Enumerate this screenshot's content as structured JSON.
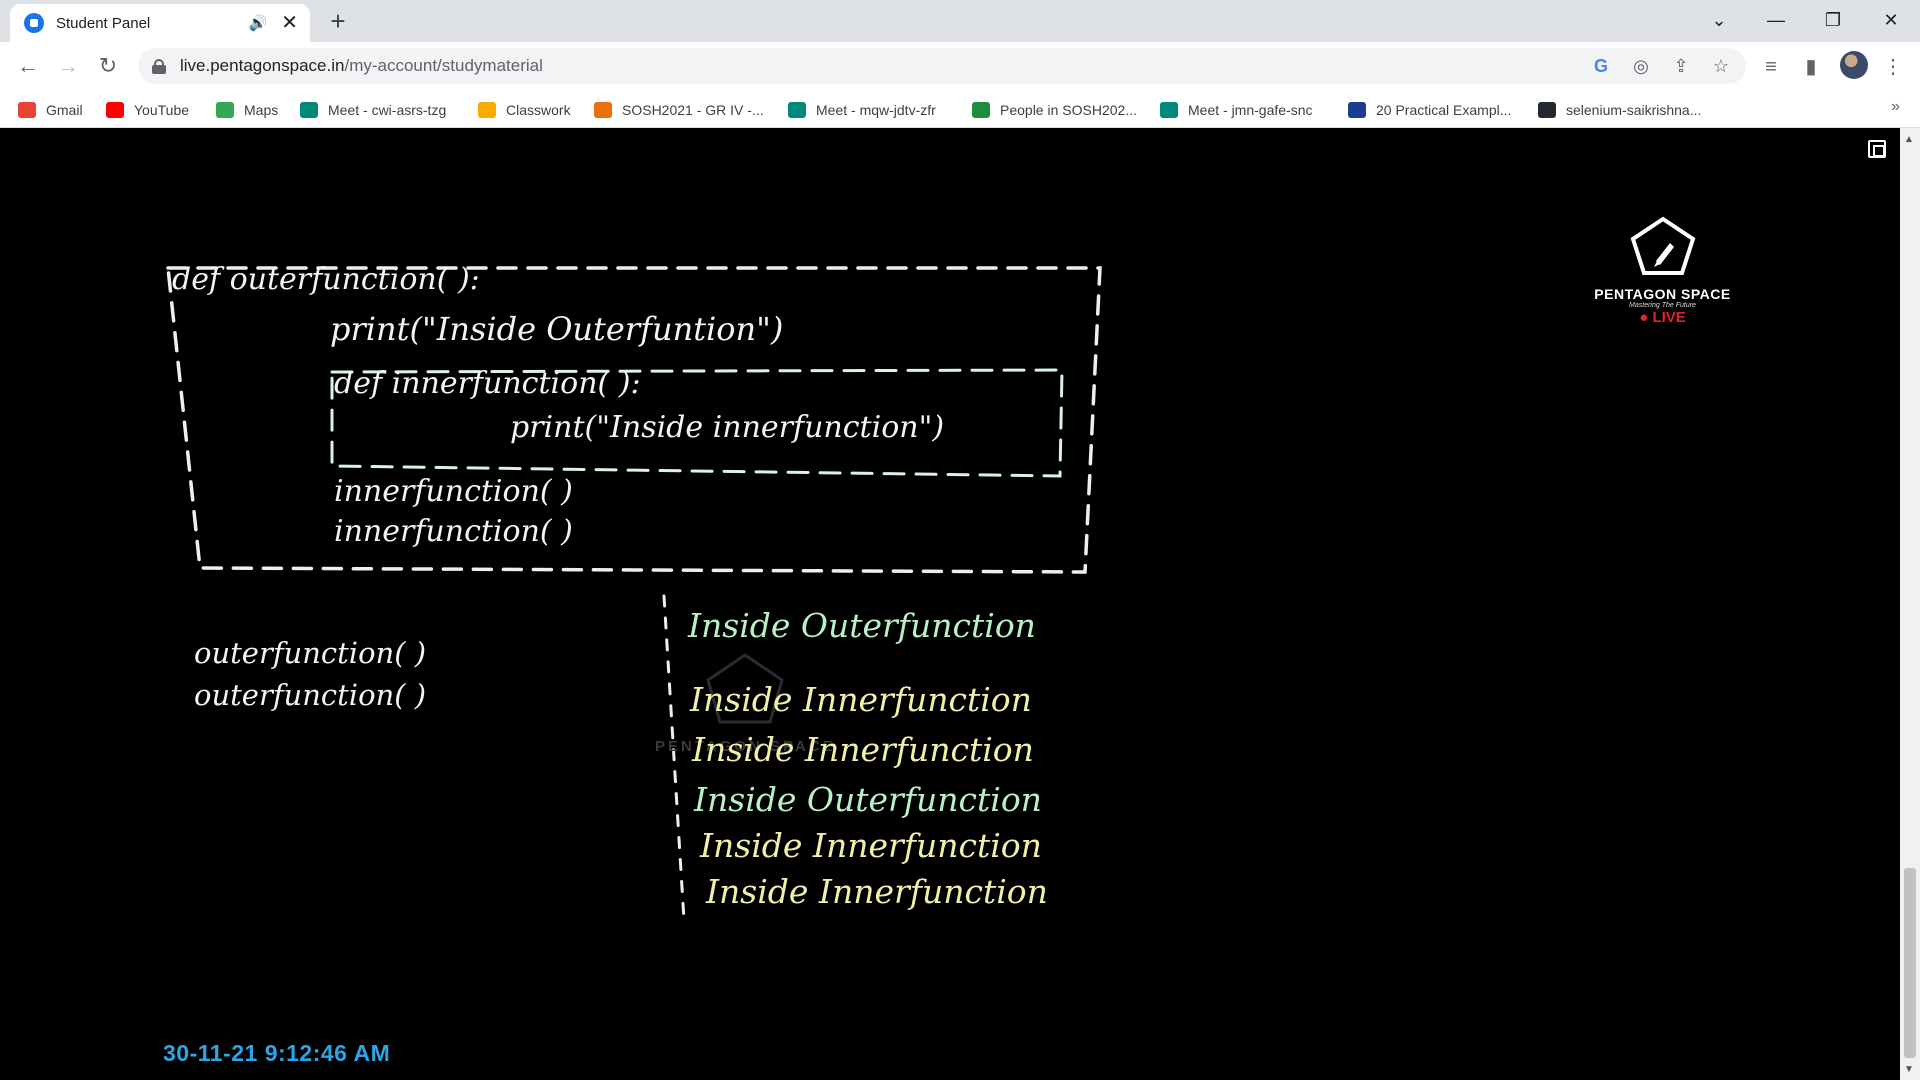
{
  "tab": {
    "title": "Student Panel"
  },
  "address_bar": {
    "domain": "live.pentagonspace.in",
    "path": "/my-account/studymaterial"
  },
  "bookmarks": [
    {
      "label": "Gmail",
      "icon": "gmail-icon",
      "color": "#ea4335"
    },
    {
      "label": "YouTube",
      "icon": "youtube-icon",
      "color": "#ff0000"
    },
    {
      "label": "Maps",
      "icon": "maps-icon",
      "color": "#34a853"
    },
    {
      "label": "Meet - cwi-asrs-tzg",
      "icon": "meet-icon",
      "color": "#00897b"
    },
    {
      "label": "Classwork",
      "icon": "classroom-icon",
      "color": "#f9ab00"
    },
    {
      "label": "SOSH2021 - GR IV -...",
      "icon": "sosh-icon",
      "color": "#e8710a"
    },
    {
      "label": "Meet - mqw-jdtv-zfr",
      "icon": "meet-icon",
      "color": "#00897b"
    },
    {
      "label": "People in SOSH202...",
      "icon": "classroom-icon",
      "color": "#1e8e3e"
    },
    {
      "label": "Meet - jmn-gafe-snc",
      "icon": "meet-icon",
      "color": "#00897b"
    },
    {
      "label": "20 Practical Exampl...",
      "icon": "shield-icon",
      "color": "#1a3d8f"
    },
    {
      "label": "selenium-saikrishna...",
      "icon": "github-icon",
      "color": "#24292f"
    }
  ],
  "video": {
    "code_lines": [
      "def outerfunction( ):",
      "print(\"Inside Outerfuntion\")",
      "def innerfunction( ):",
      "print(\"Inside innerfunction\")",
      "innerfunction( )",
      "innerfunction( )"
    ],
    "calls": [
      "outerfunction( )",
      "outerfunction( )"
    ],
    "output_lines": [
      "Inside Outerfunction",
      "Inside Innerfunction",
      "Inside Innerfunction",
      "Inside Outerfunction",
      "Inside Innerfunction",
      "Inside Innerfunction"
    ],
    "logo": {
      "name": "PENTAGON SPACE",
      "tagline": "Mastering The Future",
      "live": "LIVE"
    },
    "timestamp": "30-11-21 9:12:46 AM"
  }
}
